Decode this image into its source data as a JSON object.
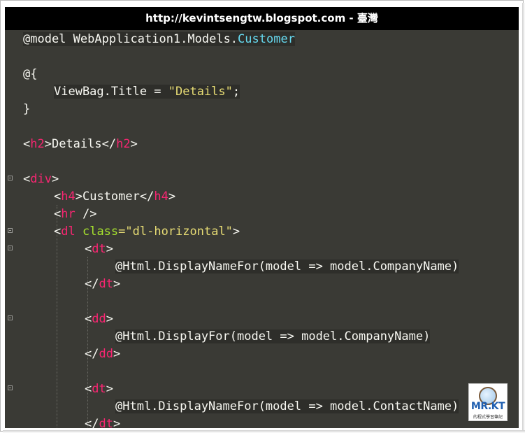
{
  "banner": {
    "text": "http://kevintsengtw.blogspot.com - 臺灣"
  },
  "code": {
    "l1": {
      "a": "@model WebApplication1.Models.",
      "b": "Customer"
    },
    "l3": {
      "a": "@{"
    },
    "l4": {
      "a": "ViewBag.Title = ",
      "b": "\"Details\"",
      "c": ";"
    },
    "l5": {
      "a": "}"
    },
    "l7": {
      "a": "<",
      "b": "h2",
      "c": ">Details</",
      "d": "h2",
      "e": ">"
    },
    "l9": {
      "a": "<",
      "b": "div",
      "c": ">"
    },
    "l10": {
      "a": "<",
      "b": "h4",
      "c": ">Customer</",
      "d": "h4",
      "e": ">"
    },
    "l11": {
      "a": "<",
      "b": "hr",
      "c": " />"
    },
    "l12": {
      "a": "<",
      "b": "dl",
      "c": " class",
      "d": "=\"dl-horizontal\"",
      "e": ">"
    },
    "l13": {
      "a": "<",
      "b": "dt",
      "c": ">"
    },
    "l14": {
      "a": "@Html.DisplayNameFor(model => model.CompanyName)"
    },
    "l15": {
      "a": "</",
      "b": "dt",
      "c": ">"
    },
    "l17": {
      "a": "<",
      "b": "dd",
      "c": ">"
    },
    "l18": {
      "a": "@Html.DisplayFor(model => model.CompanyName)"
    },
    "l19": {
      "a": "</",
      "b": "dd",
      "c": ">"
    },
    "l21": {
      "a": "<",
      "b": "dt",
      "c": ">"
    },
    "l22": {
      "a": "@Html.DisplayNameFor(model => model.ContactName)"
    },
    "l23": {
      "a": "</",
      "b": "dt",
      "c": ">"
    }
  },
  "logo": {
    "title": "MR.KT",
    "subtitle": "的程式學習筆記"
  },
  "colors": {
    "background": "#3a3a35",
    "tag": "#f92672",
    "string": "#e6db74",
    "attribute": "#a6e22e",
    "type": "#66d9ef",
    "text": "#f8f8f2"
  }
}
